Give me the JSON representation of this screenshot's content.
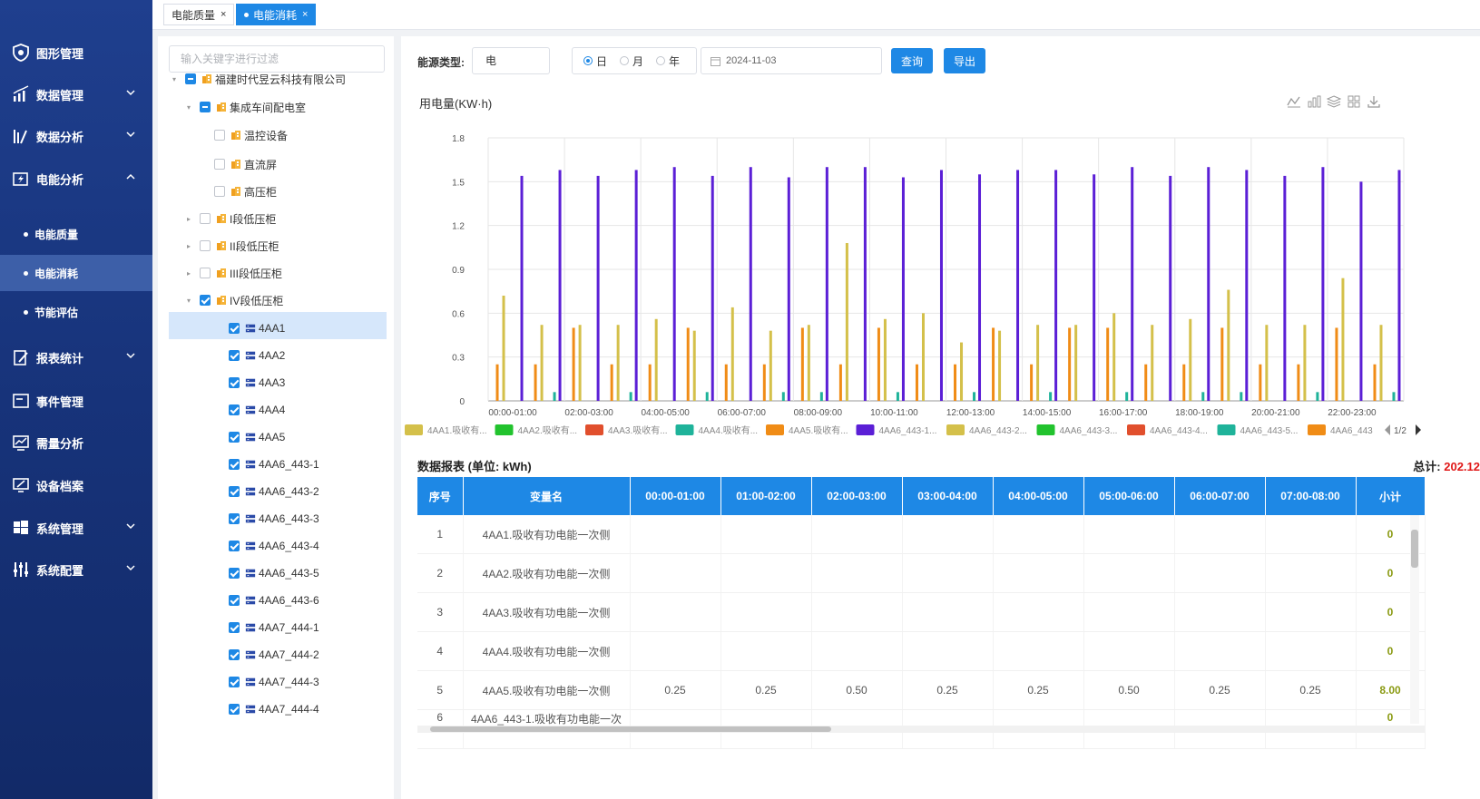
{
  "tabs": [
    {
      "label": "电能质量",
      "close": "×",
      "active": false
    },
    {
      "label": "电能消耗",
      "close": "×",
      "active": true
    }
  ],
  "sidebar": {
    "items": [
      {
        "label": "图形管理",
        "icon": "shield-icon"
      },
      {
        "label": "数据管理",
        "icon": "bar-chart-icon"
      },
      {
        "label": "数据分析",
        "icon": "analytics-icon"
      },
      {
        "label": "电能分析",
        "icon": "energy-icon"
      },
      {
        "label": "报表统计",
        "icon": "report-icon"
      },
      {
        "label": "事件管理",
        "icon": "event-icon"
      },
      {
        "label": "需量分析",
        "icon": "demand-icon"
      },
      {
        "label": "设备档案",
        "icon": "device-icon"
      },
      {
        "label": "系统管理",
        "icon": "windows-icon"
      },
      {
        "label": "系统配置",
        "icon": "sliders-icon"
      }
    ],
    "sub_items": [
      {
        "label": "电能质量"
      },
      {
        "label": "电能消耗",
        "active": true
      },
      {
        "label": "节能评估"
      }
    ]
  },
  "tree": {
    "filter_placeholder": "输入关键字进行过滤",
    "nodes": [
      {
        "label": "福建时代昱云科技有限公司"
      },
      {
        "label": "集成车间配电室"
      },
      {
        "label": "温控设备"
      },
      {
        "label": "直流屏"
      },
      {
        "label": "高压柜"
      },
      {
        "label": "I段低压柜"
      },
      {
        "label": "II段低压柜"
      },
      {
        "label": "III段低压柜"
      },
      {
        "label": "IV段低压柜"
      },
      {
        "label": "4AA1"
      },
      {
        "label": "4AA2"
      },
      {
        "label": "4AA3"
      },
      {
        "label": "4AA4"
      },
      {
        "label": "4AA5"
      },
      {
        "label": "4AA6_443-1"
      },
      {
        "label": "4AA6_443-2"
      },
      {
        "label": "4AA6_443-3"
      },
      {
        "label": "4AA6_443-4"
      },
      {
        "label": "4AA6_443-5"
      },
      {
        "label": "4AA6_443-6"
      },
      {
        "label": "4AA7_444-1"
      },
      {
        "label": "4AA7_444-2"
      },
      {
        "label": "4AA7_444-3"
      },
      {
        "label": "4AA7_444-4"
      }
    ]
  },
  "filters": {
    "energy_label": "能源类型:",
    "energy_value": "电",
    "radio": [
      "日",
      "月",
      "年"
    ],
    "selected": "日",
    "date": "2024-11-03",
    "query_label": "查询",
    "export_label": "导出"
  },
  "chart_title": "用电量(KW·h)",
  "legend": {
    "items": [
      {
        "label": "4AA1.吸收有...",
        "color": "#d4c04a"
      },
      {
        "label": "4AA2.吸收有...",
        "color": "#22c32e"
      },
      {
        "label": "4AA3.吸收有...",
        "color": "#e14f2d"
      },
      {
        "label": "4AA4.吸收有...",
        "color": "#1fb39a"
      },
      {
        "label": "4AA5.吸收有...",
        "color": "#f08c16"
      },
      {
        "label": "4AA6_443-1...",
        "color": "#5b1fd6"
      },
      {
        "label": "4AA6_443-2...",
        "color": "#d4c04a"
      },
      {
        "label": "4AA6_443-3...",
        "color": "#22c32e"
      },
      {
        "label": "4AA6_443-4...",
        "color": "#e14f2d"
      },
      {
        "label": "4AA6_443-5...",
        "color": "#1fb39a"
      },
      {
        "label": "4AA6_443",
        "color": "#f08c16"
      }
    ],
    "page": "1/2"
  },
  "chart_data": {
    "type": "bar",
    "categories": [
      "00:00-01:00",
      "01:00-02:00",
      "02:00-03:00",
      "03:00-04:00",
      "04:00-05:00",
      "05:00-06:00",
      "06:00-07:00",
      "07:00-08:00",
      "08:00-09:00",
      "09:00-10:00",
      "10:00-11:00",
      "11:00-12:00",
      "12:00-13:00",
      "13:00-14:00",
      "14:00-15:00",
      "15:00-16:00",
      "16:00-17:00",
      "17:00-18:00",
      "18:00-19:00",
      "19:00-20:00",
      "20:00-21:00",
      "21:00-22:00",
      "22:00-23:00",
      "23:00-24:00"
    ],
    "x_tick_labels": [
      "00:00-01:00",
      "02:00-03:00",
      "04:00-05:00",
      "06:00-07:00",
      "08:00-09:00",
      "10:00-11:00",
      "12:00-13:00",
      "14:00-15:00",
      "16:00-17:00",
      "18:00-19:00",
      "20:00-21:00",
      "22:00-23:00"
    ],
    "ylim": [
      0,
      1.8
    ],
    "y_ticks": [
      0,
      0.3,
      0.6,
      0.9,
      1.2,
      1.5,
      1.8
    ],
    "series": [
      {
        "name": "4AA5.吸收有功电能一次侧",
        "color": "#f08c16",
        "values": [
          0.25,
          0.25,
          0.5,
          0.25,
          0.25,
          0.5,
          0.25,
          0.25,
          0.5,
          0.25,
          0.5,
          0.25,
          0.25,
          0.5,
          0.25,
          0.5,
          0.5,
          0.25,
          0.25,
          0.5,
          0.25,
          0.25,
          0.5,
          0.25
        ]
      },
      {
        "name": "4AA6_443-2",
        "color": "#d4c04a",
        "values": [
          0.72,
          0.52,
          0.52,
          0.52,
          0.56,
          0.48,
          0.64,
          0.48,
          0.52,
          1.08,
          0.56,
          0.6,
          0.4,
          0.48,
          0.52,
          0.52,
          0.6,
          0.52,
          0.56,
          0.76,
          0.52,
          0.52,
          0.84,
          0.52
        ]
      },
      {
        "name": "4AA4",
        "color": "#1fb39a",
        "values": [
          0,
          0.06,
          0,
          0.06,
          0,
          0.06,
          0,
          0.06,
          0.06,
          0,
          0.06,
          0,
          0.06,
          0,
          0.06,
          0,
          0.06,
          0,
          0.06,
          0.06,
          0,
          0.06,
          0,
          0.06
        ]
      },
      {
        "name": "4AA6_443-1",
        "color": "#5b1fd6",
        "values": [
          1.54,
          1.58,
          1.54,
          1.58,
          1.6,
          1.54,
          1.6,
          1.53,
          1.6,
          1.6,
          1.53,
          1.58,
          1.55,
          1.58,
          1.58,
          1.55,
          1.6,
          1.54,
          1.6,
          1.58,
          1.54,
          1.6,
          1.5,
          1.58
        ]
      }
    ]
  },
  "report": {
    "title": "数据报表 (单位: kWh)",
    "total_label": "总计:",
    "total_value": "202.12",
    "columns": [
      "序号",
      "变量名",
      "00:00-01:00",
      "01:00-02:00",
      "02:00-03:00",
      "03:00-04:00",
      "04:00-05:00",
      "05:00-06:00",
      "06:00-07:00",
      "07:00-08:00",
      "小计"
    ],
    "rows": [
      [
        "1",
        "4AA1.吸收有功电能一次侧",
        "",
        "",
        "",
        "",
        "",
        "",
        "",
        "",
        "0"
      ],
      [
        "2",
        "4AA2.吸收有功电能一次侧",
        "",
        "",
        "",
        "",
        "",
        "",
        "",
        "",
        "0"
      ],
      [
        "3",
        "4AA3.吸收有功电能一次侧",
        "",
        "",
        "",
        "",
        "",
        "",
        "",
        "",
        "0"
      ],
      [
        "4",
        "4AA4.吸收有功电能一次侧",
        "",
        "",
        "",
        "",
        "",
        "",
        "",
        "",
        "0"
      ],
      [
        "5",
        "4AA5.吸收有功电能一次侧",
        "0.25",
        "0.25",
        "0.50",
        "0.25",
        "0.25",
        "0.50",
        "0.25",
        "0.25",
        "8.00"
      ],
      [
        "6",
        "4AA6_443-1.吸收有功电能一次",
        "",
        "",
        "",
        "",
        "",
        "",
        "",
        "",
        "0"
      ]
    ]
  }
}
